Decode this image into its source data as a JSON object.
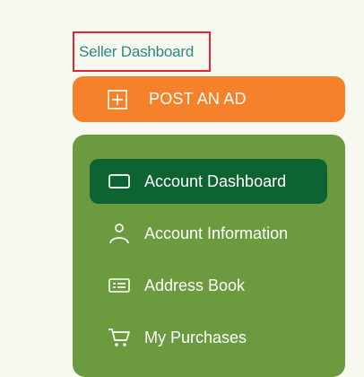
{
  "header": {
    "title": "Seller Dashboard"
  },
  "post_ad": {
    "label": "POST AN AD",
    "icon": "plus-square-icon"
  },
  "sidebar": {
    "items": [
      {
        "label": "Account Dashboard",
        "icon": "monitor-icon",
        "active": true
      },
      {
        "label": "Account Information",
        "icon": "user-icon",
        "active": false
      },
      {
        "label": "Address Book",
        "icon": "address-card-icon",
        "active": false
      },
      {
        "label": "My Purchases",
        "icon": "cart-icon",
        "active": false
      }
    ]
  },
  "colors": {
    "background": "#f7f8ef",
    "title_text": "#2b8a7f",
    "highlight_border": "#e8242e",
    "post_ad_bg": "#f5822a",
    "menu_bg": "#6b9a3f",
    "active_item_bg": "#0d6331"
  }
}
